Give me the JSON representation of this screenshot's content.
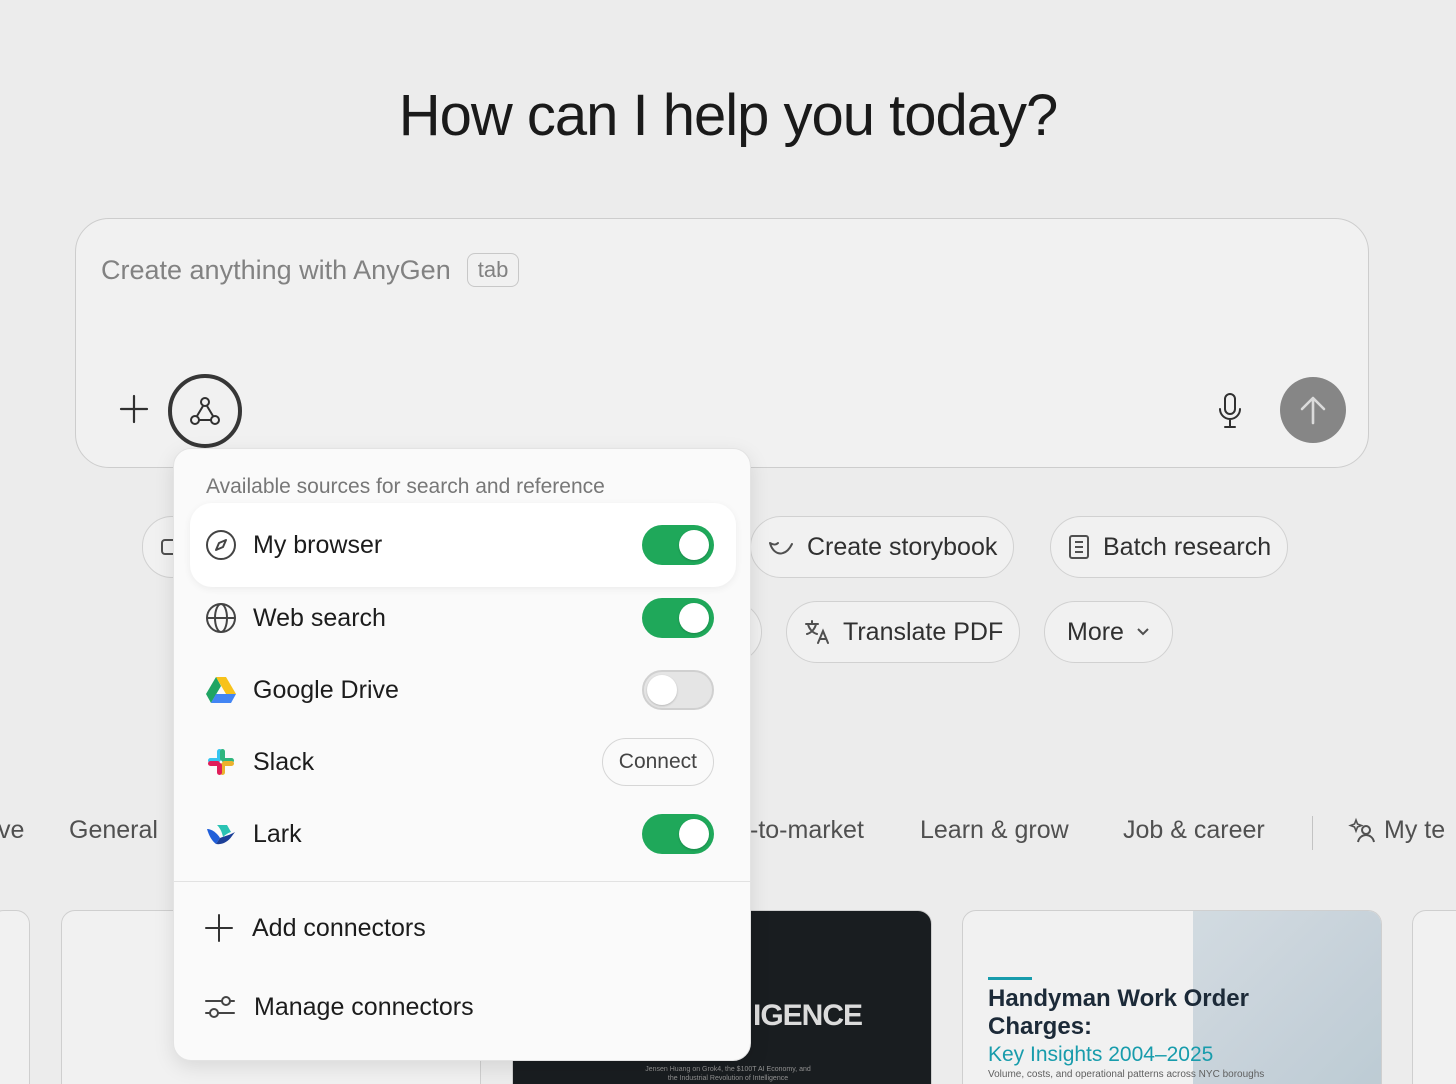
{
  "hero": {
    "title": "How can I help you today?"
  },
  "composer": {
    "placeholder": "Create anything with AnyGen",
    "shortcut_hint": "tab"
  },
  "quick_actions": [
    {
      "label": "Create storybook",
      "icon": "storybook-icon"
    },
    {
      "label": "Batch research",
      "icon": "book-icon"
    },
    {
      "label": "Translate PDF",
      "icon": "translate-icon"
    },
    {
      "label": "More",
      "icon": "chevron-down-icon"
    }
  ],
  "categories": [
    "ve",
    "General",
    "-to-market",
    "Learn & grow",
    "Job & career",
    "My te"
  ],
  "cards": {
    "dark": {
      "headline": "IGENCE",
      "subtitle": "Jensen Huang on Grok4, the $100T AI Economy, and the Industrial Revolution of Intelligence"
    },
    "report": {
      "title": "Handyman Work Order Charges:",
      "subtitle": "Key Insights 2004–2025",
      "note": "Volume, costs, and operational patterns across NYC boroughs"
    }
  },
  "popover": {
    "header": "Available sources for search and reference",
    "sources": [
      {
        "label": "My browser",
        "icon": "compass-icon",
        "control": "toggle",
        "enabled": true
      },
      {
        "label": "Web search",
        "icon": "globe-icon",
        "control": "toggle",
        "enabled": true
      },
      {
        "label": "Google Drive",
        "icon": "google-drive-icon",
        "control": "toggle",
        "enabled": false
      },
      {
        "label": "Slack",
        "icon": "slack-icon",
        "control": "button",
        "button_label": "Connect"
      },
      {
        "label": "Lark",
        "icon": "lark-icon",
        "control": "toggle",
        "enabled": true
      }
    ],
    "actions": [
      {
        "label": "Add connectors",
        "icon": "plus-icon"
      },
      {
        "label": "Manage connectors",
        "icon": "sliders-icon"
      }
    ]
  },
  "colors": {
    "toggle_on": "#1fa85a",
    "send_button": "#8e8e8e",
    "accent_teal": "#1aa6b7"
  }
}
